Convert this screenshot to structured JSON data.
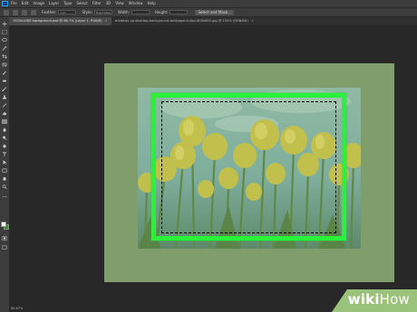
{
  "app": {
    "logo": "Ps",
    "menu": [
      "File",
      "Edit",
      "Image",
      "Layer",
      "Type",
      "Select",
      "Filter",
      "3D",
      "View",
      "Window",
      "Help"
    ]
  },
  "options_bar": {
    "feather_label": "Feather:",
    "feather_value": "0 px",
    "style_label": "Style:",
    "style_value": "Fixed Ratio",
    "width_label": "Width:",
    "height_label": "Height:",
    "select_mask_label": "Select and Mask..."
  },
  "tabs": [
    {
      "label": "1920x1080 background.psd @ 66.7% (Layer 1, RGB/8)",
      "active": true
    },
    {
      "label": "windows-xp-desktop-background-wallpaper-tulips-800x600.jpg @ 100% (RGB/8#)",
      "active": false
    }
  ],
  "status": {
    "zoom": "66.67%"
  },
  "colors": {
    "selection_highlight": "#29f23a",
    "canvas_bg": "#7f9e6b",
    "foreground_swatch": "#ffffff",
    "background_swatch": "#3d8c2f"
  },
  "watermark": {
    "part1": "wiki",
    "part2": "How"
  }
}
